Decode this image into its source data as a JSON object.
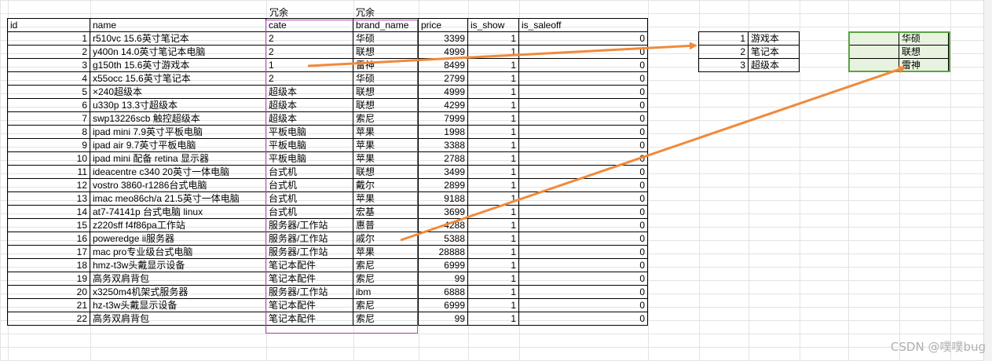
{
  "notes": {
    "redundant_cate": "冗余",
    "redundant_brand": "冗余"
  },
  "headers": [
    "id",
    "name",
    "cate",
    "brand_name",
    "price",
    "is_show",
    "is_saleoff"
  ],
  "rows": [
    [
      "1",
      "r510vc 15.6英寸笔记本",
      "2",
      "华硕",
      "3399",
      "1",
      "0"
    ],
    [
      "2",
      "y400n 14.0英寸笔记本电脑",
      "2",
      "联想",
      "4999",
      "1",
      "0"
    ],
    [
      "3",
      "g150th 15.6英寸游戏本",
      "1",
      "雷神",
      "8499",
      "1",
      "0"
    ],
    [
      "4",
      "x55occ 15.6英寸笔记本",
      "2",
      "华硕",
      "2799",
      "1",
      "0"
    ],
    [
      "5",
      "×240超级本",
      "超级本",
      "联想",
      "4999",
      "1",
      "0"
    ],
    [
      "6",
      "u330p 13.3寸超级本",
      "超级本",
      "联想",
      "4299",
      "1",
      "0"
    ],
    [
      "7",
      "swp13226scb 触控超级本",
      "超级本",
      "索尼",
      "7999",
      "1",
      "0"
    ],
    [
      "8",
      "ipad mini 7.9英寸平板电脑",
      "平板电脑",
      "苹果",
      "1998",
      "1",
      "0"
    ],
    [
      "9",
      "ipad air 9.7英寸平板电脑",
      "平板电脑",
      "苹果",
      "3388",
      "1",
      "0"
    ],
    [
      "10",
      "ipad mini 配备 retina 显示器",
      "平板电脑",
      "苹果",
      "2788",
      "1",
      "0"
    ],
    [
      "11",
      "ideacentre c340 20英寸一体电脑",
      "台式机",
      "联想",
      "3499",
      "1",
      "0"
    ],
    [
      "12",
      "vostro 3860-r1286台式电脑",
      "台式机",
      "戴尔",
      "2899",
      "1",
      "0"
    ],
    [
      "13",
      "imac meo86ch/a 21.5英寸一体电脑",
      "台式机",
      "苹果",
      "9188",
      "1",
      "0"
    ],
    [
      "14",
      "at7-74141p 台式电脑 linux",
      "台式机",
      "宏基",
      "3699",
      "1",
      "0"
    ],
    [
      "15",
      "z220sff f4f86pa工作站",
      "服务器/工作站",
      "惠普",
      "4288",
      "1",
      "0"
    ],
    [
      "16",
      "poweredge ii服务器",
      "服务器/工作站",
      "戚尔",
      "5388",
      "1",
      "0"
    ],
    [
      "17",
      "mac pro专业级台式电脑",
      "服务器/工作站",
      "苹果",
      "28888",
      "1",
      "0"
    ],
    [
      "18",
      "hmz-t3w头戴显示设备",
      "笔记本配件",
      "索尼",
      "6999",
      "1",
      "0"
    ],
    [
      "19",
      "高务双肩背包",
      "笔记本配件",
      "索尼",
      "99",
      "1",
      "0"
    ],
    [
      "20",
      "x3250m4机架式服务器",
      "服务器/工作站",
      " ibm",
      "6888",
      "1",
      "0"
    ],
    [
      "21",
      "hz-t3w头戴显示设备",
      "笔记本配件",
      "索尼",
      "6999",
      "1",
      "0"
    ],
    [
      "22",
      "高务双肩背包",
      "笔记本配件",
      "索尼",
      "99",
      "1",
      "0"
    ]
  ],
  "cate_table": [
    [
      "1",
      "游戏本"
    ],
    [
      "2",
      "笔记本"
    ],
    [
      "3",
      "超级本"
    ]
  ],
  "brand_table": [
    "华硕",
    "联想",
    "雷神"
  ],
  "watermark": "CSDN @噗噗bug",
  "colors": {
    "arrow": "#f08a3c",
    "redundant_box": "#c040c0",
    "selection_border": "#5aa342",
    "selection_fill": "#e7f3df"
  }
}
